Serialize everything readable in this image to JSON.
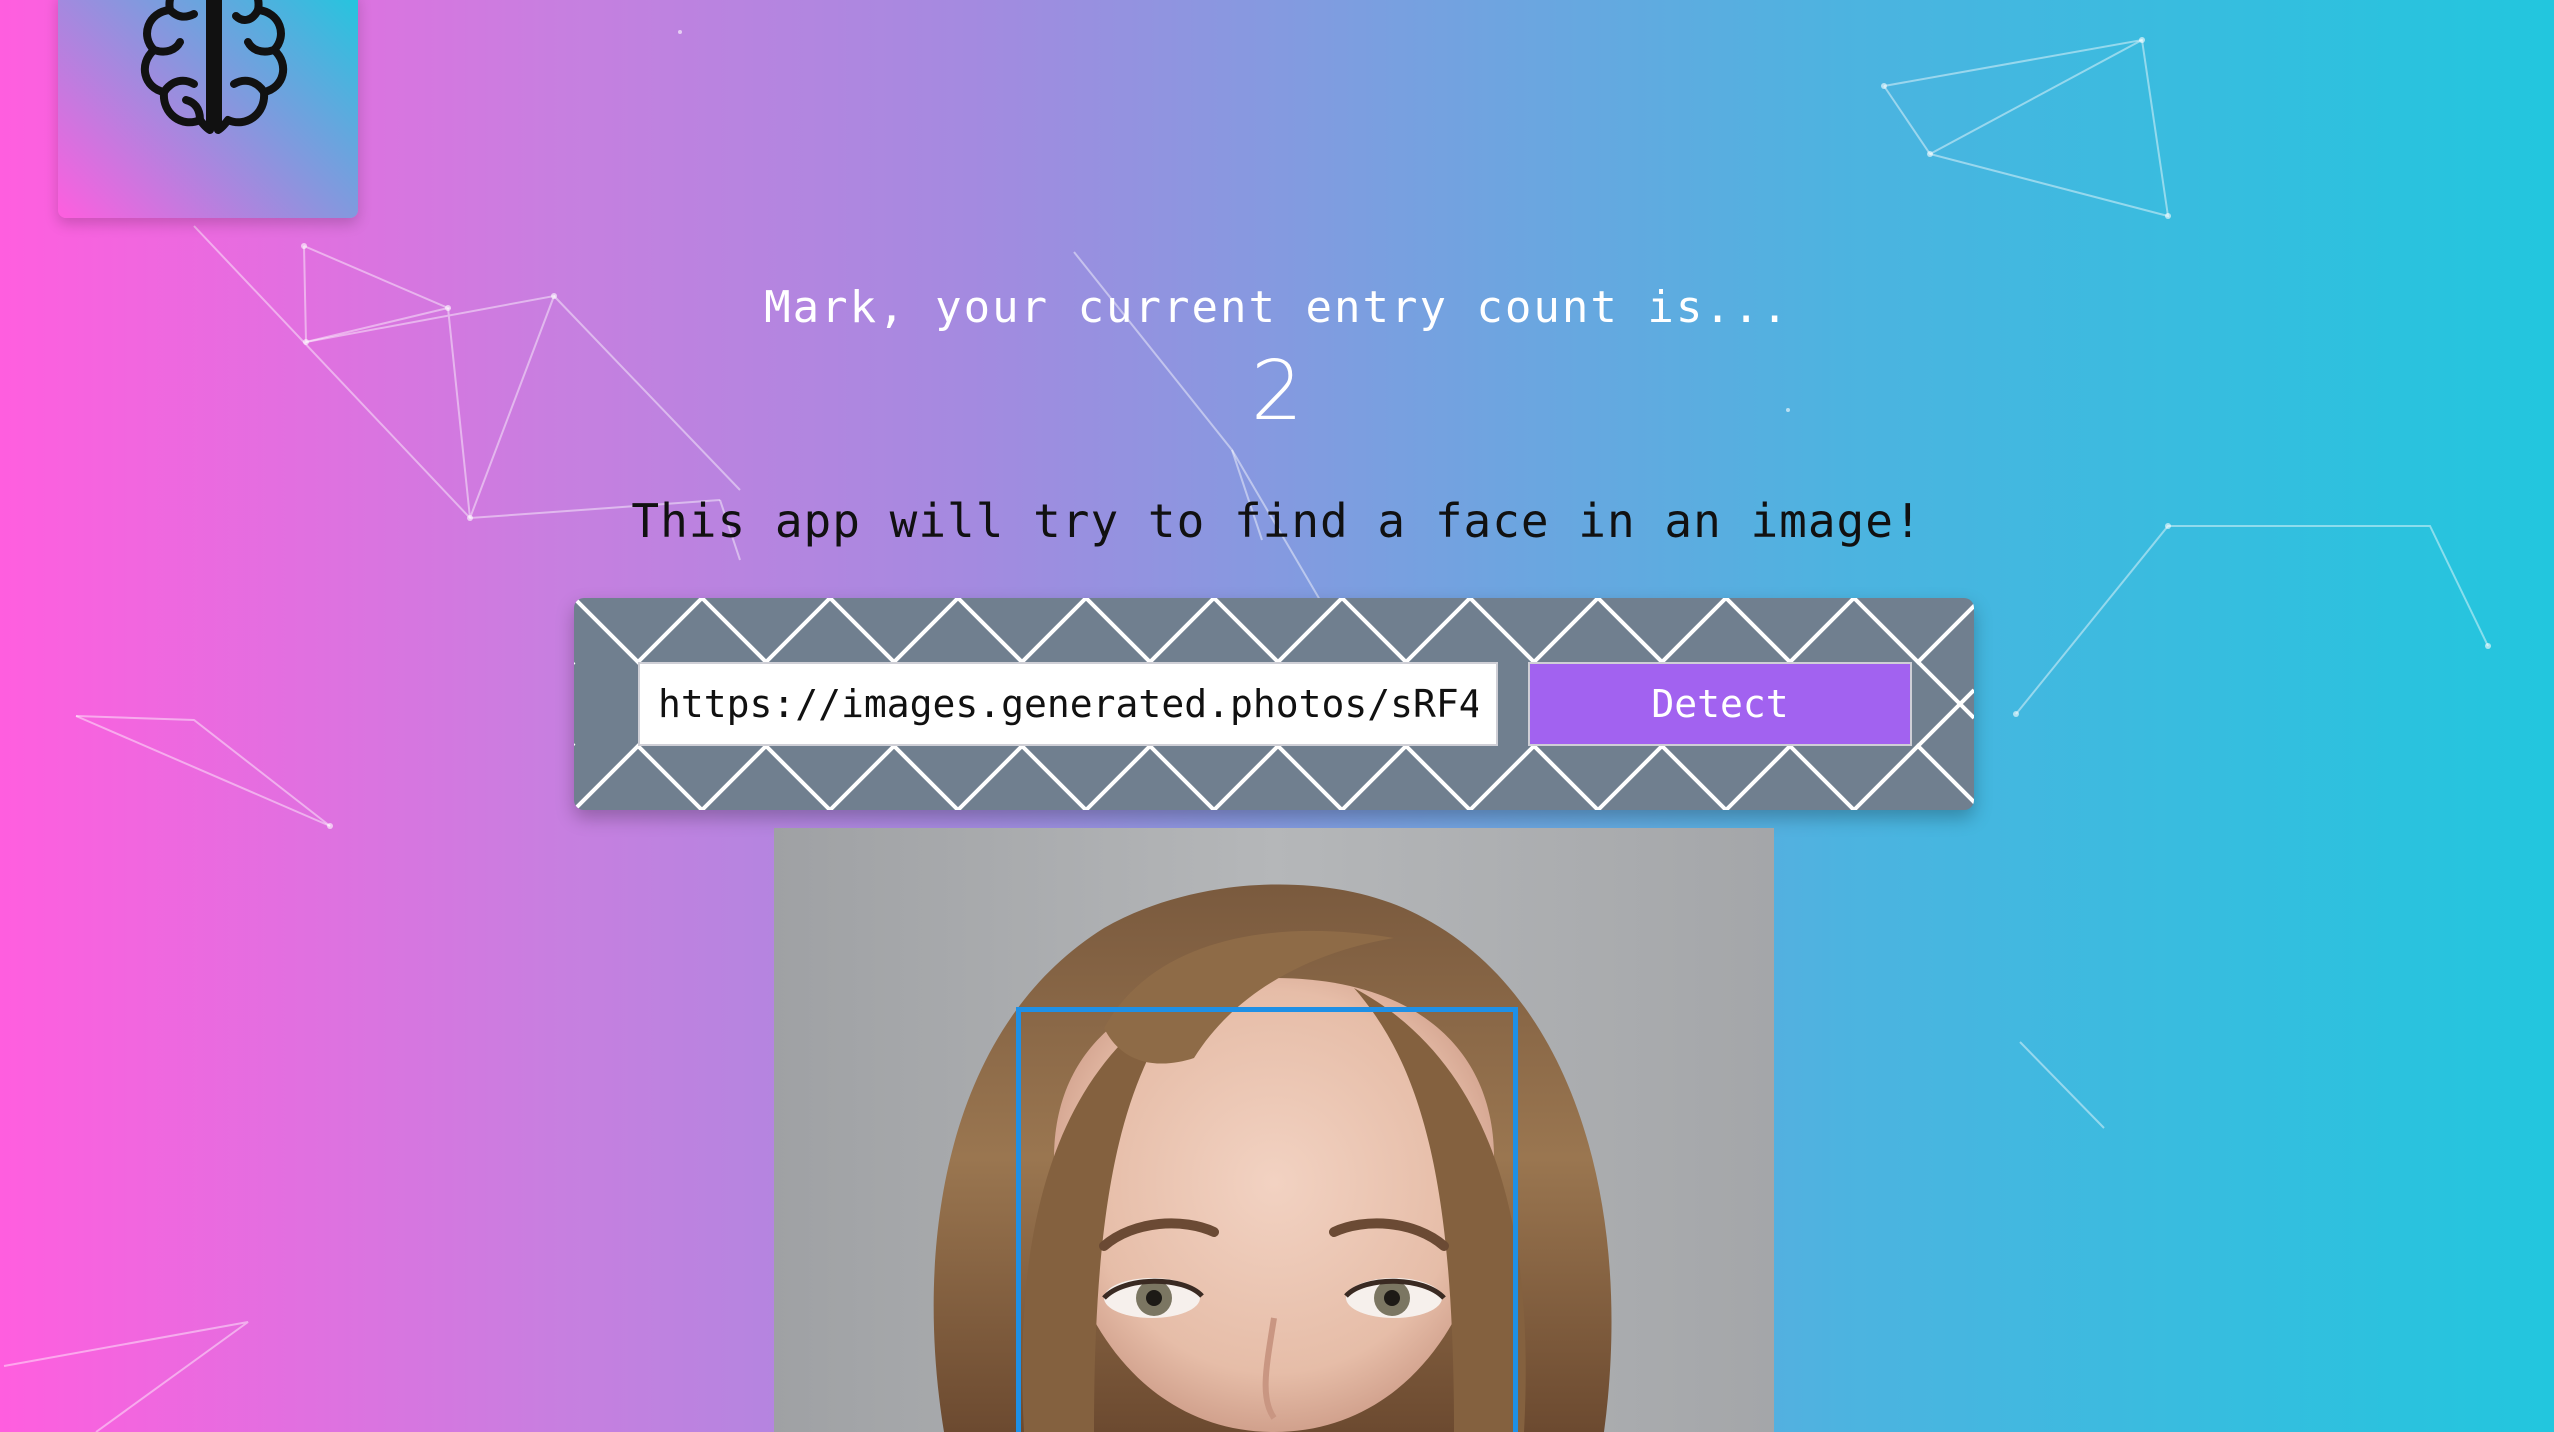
{
  "logo": {
    "icon": "brain-icon"
  },
  "greeting": {
    "text": "Mark, your current entry count is...",
    "count": "2"
  },
  "tagline": "This app will try to find a face in an image!",
  "form": {
    "url_value": "https://images.generated.photos/sRF4",
    "detect_label": "Detect"
  },
  "result": {
    "image": "face-photo",
    "box_color": "#1e90e6"
  },
  "colors": {
    "gradient_start": "#ff5edf",
    "gradient_end": "#22c6de",
    "button": "#a262f0",
    "panel": "#707f8f"
  }
}
